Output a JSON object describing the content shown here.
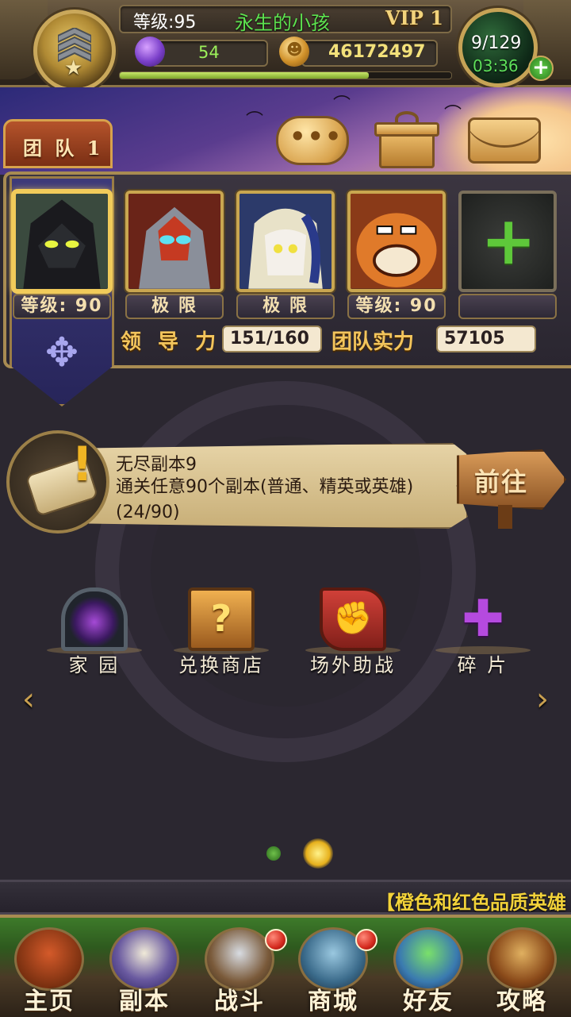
{
  "player": {
    "level_text": "等级:95",
    "name": "永生的小孩",
    "vip": "VIP 1",
    "gems": "54",
    "gold": "46172497",
    "exp_progress": 0.75,
    "stamina": "9/129",
    "stamina_timer": "03:36",
    "add_label": "+"
  },
  "toolbar": {
    "team_tab": "团 队 1",
    "chat_label": "•••"
  },
  "team": {
    "heroes": [
      {
        "label": "等级: 90",
        "art": "dark-knight"
      },
      {
        "label": "极 限",
        "art": "armored-warrior"
      },
      {
        "label": "极 限",
        "art": "hooded-mage"
      },
      {
        "label": "等级: 90",
        "art": "orc-brute"
      }
    ],
    "add_hero_label": "+",
    "leadership_label": "领 导 力",
    "leadership_value": "151/160",
    "power_label": "团队实力",
    "power_value": "57105"
  },
  "quest": {
    "title": "无尽副本9",
    "description": "通关任意90个副本(普通、精英或英雄)(24/90)",
    "go_label": "前往"
  },
  "features": [
    {
      "label": "家 园",
      "icon": "portal-icon"
    },
    {
      "label": "兑换商店",
      "icon": "mystery-chest-icon"
    },
    {
      "label": "场外助战",
      "icon": "fist-banner-icon"
    },
    {
      "label": "碎 片",
      "icon": "puzzle-piece-icon"
    }
  ],
  "pager": {
    "current": 2,
    "total": 2
  },
  "marquee": "【橙色和红色品质英雄",
  "nav": [
    {
      "label": "主页",
      "icon": "house-icon",
      "badge": false
    },
    {
      "label": "副本",
      "icon": "skull-orb-icon",
      "badge": false
    },
    {
      "label": "战斗",
      "icon": "sword-axe-icon",
      "badge": true
    },
    {
      "label": "商城",
      "icon": "monster-merchant-icon",
      "badge": true
    },
    {
      "label": "好友",
      "icon": "friends-icon",
      "badge": false
    },
    {
      "label": "攻略",
      "icon": "guide-book-icon",
      "badge": false
    }
  ],
  "colors": {
    "name_green": "#5de24f",
    "gold_text": "#f3e17a",
    "marquee_yellow": "#f2d23a",
    "badge_red": "#d42a1e"
  }
}
